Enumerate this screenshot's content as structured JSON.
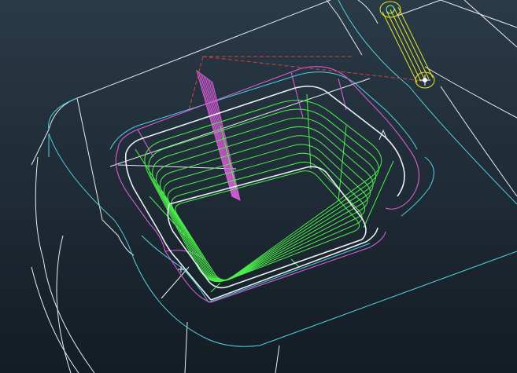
{
  "viewport": {
    "background_top": "#2a3a47",
    "background_bottom": "#141c24"
  },
  "colors": {
    "white_edges": "#e8eef2",
    "part_edges": "#4fd0e0",
    "pocket_boundary": "#d85cd8",
    "toolpath": "#4cf04c",
    "pocket_floor": "#e8f0f4",
    "reference_dashed": "#d84040",
    "tool": "#e6e62a",
    "tool_center": "#ffffff",
    "tool_tip": "#7fff7f"
  },
  "entities": [
    {
      "name": "part-outline",
      "kind": "wireframe"
    },
    {
      "name": "pocket-boundary",
      "kind": "boundary"
    },
    {
      "name": "toolpath",
      "kind": "finishing passes"
    },
    {
      "name": "cutting-tool",
      "kind": "cylindrical tool"
    },
    {
      "name": "cross-section",
      "kind": "hatched plane"
    }
  ]
}
